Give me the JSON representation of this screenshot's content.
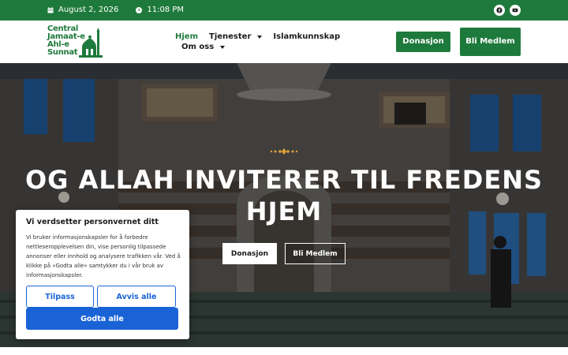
{
  "topbar": {
    "date": "August 2, 2026",
    "time": "11:08 PM",
    "bg_color": "#1e7a3c",
    "icons": [
      "calendar-icon",
      "clock-icon",
      "facebook-icon",
      "youtube-icon"
    ]
  },
  "logo": {
    "line1": "Central",
    "line2": "Jamaat-e",
    "line3": "Ahl-e",
    "line4": "Sunnat"
  },
  "nav": {
    "items": [
      {
        "label": "Hjem",
        "active": true
      },
      {
        "label": "Tjenester",
        "dropdown": true
      },
      {
        "label": "Islamkunnskap"
      },
      {
        "label": "Om oss",
        "dropdown": true
      }
    ]
  },
  "header_buttons": {
    "donate": "Donasjon",
    "member": "Bli Medlem"
  },
  "hero": {
    "title": "OG ALLAH INVITERER TIL FREDENS HJEM",
    "donate": "Donasjon",
    "member": "Bli Medlem"
  },
  "cookie": {
    "title": "Vi verdsetter personvernet ditt",
    "text": "Vi bruker informasjonskapsler for å forbedre nettleseropplevelsen din, vise personlig tilpassede annonser eller innhold og analysere trafikken vår. Ved å klikke på «Godta alle» samtykker du i vår bruk av informasjonskapsler.",
    "customize": "Tilpass",
    "reject": "Avvis alle",
    "accept": "Godta alle",
    "accent": "#1a63d6"
  }
}
